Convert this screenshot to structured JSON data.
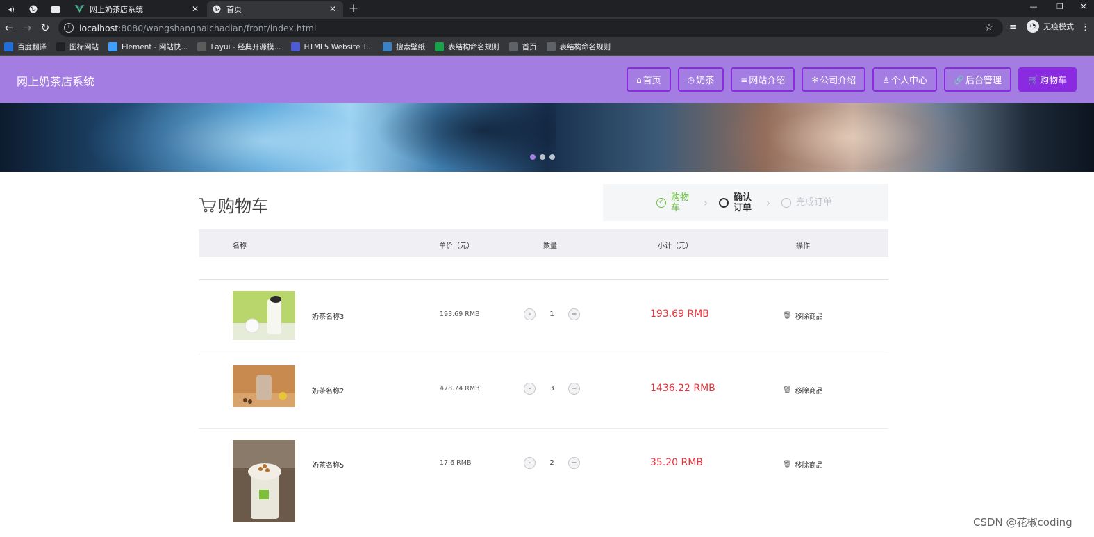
{
  "browser": {
    "tabs": [
      {
        "title": "网上奶茶店系统"
      },
      {
        "title": "首页"
      }
    ],
    "url_host": "localhost",
    "url_path": ":8080/wangshangnaichadian/front/index.html",
    "incognito_label": "无痕模式",
    "bookmarks": [
      {
        "label": "百度翻译",
        "icon": "translate-icon",
        "color": "#1e6fd9"
      },
      {
        "label": "图标网站",
        "icon": "flag-icon",
        "color": "#202124"
      },
      {
        "label": "Element - 网站快...",
        "icon": "element-icon",
        "color": "#409eff"
      },
      {
        "label": "Layui - 经典开源模...",
        "icon": "layui-icon",
        "color": "#5c5c5c"
      },
      {
        "label": "HTML5 Website T...",
        "icon": "html5-icon",
        "color": "#4f5bd5"
      },
      {
        "label": "搜索壁纸",
        "icon": "wallpaper-icon",
        "color": "#3b82c4"
      },
      {
        "label": "表结构命名规则",
        "icon": "sheet-icon",
        "color": "#16a34a"
      },
      {
        "label": "首页",
        "icon": "globe-icon",
        "color": "#5f6368"
      },
      {
        "label": "表结构命名规则",
        "icon": "globe-icon",
        "color": "#5f6368"
      }
    ]
  },
  "site": {
    "title": "网上奶茶店系统",
    "nav": [
      {
        "label": "首页",
        "icon": "⌂"
      },
      {
        "label": "奶茶",
        "icon": "◷"
      },
      {
        "label": "网站介绍",
        "icon": "≡"
      },
      {
        "label": "公司介绍",
        "icon": "✻"
      },
      {
        "label": "个人中心",
        "icon": "♙"
      },
      {
        "label": "后台管理",
        "icon": "🔗"
      },
      {
        "label": "购物车",
        "icon": "🛒"
      }
    ],
    "accent": "#8a2be2",
    "header_bg": "#a37de2"
  },
  "cart": {
    "title": "购物车",
    "steps": [
      {
        "label": "购物车",
        "state": "done"
      },
      {
        "label": "确认订单",
        "state": "active"
      },
      {
        "label": "完成订单",
        "state": "pending"
      }
    ],
    "columns": [
      "名称",
      "单价（元）",
      "数量",
      "小计（元）",
      "操作"
    ],
    "remove_label": "移除商品",
    "items": [
      {
        "name": "奶茶名称3",
        "price": "193.69 RMB",
        "qty": "1",
        "subtotal": "193.69 RMB"
      },
      {
        "name": "奶茶名称2",
        "price": "478.74 RMB",
        "qty": "3",
        "subtotal": "1436.22 RMB"
      },
      {
        "name": "奶茶名称5",
        "price": "17.6 RMB",
        "qty": "2",
        "subtotal": "35.20 RMB"
      }
    ]
  },
  "watermark": "CSDN @花椒coding"
}
